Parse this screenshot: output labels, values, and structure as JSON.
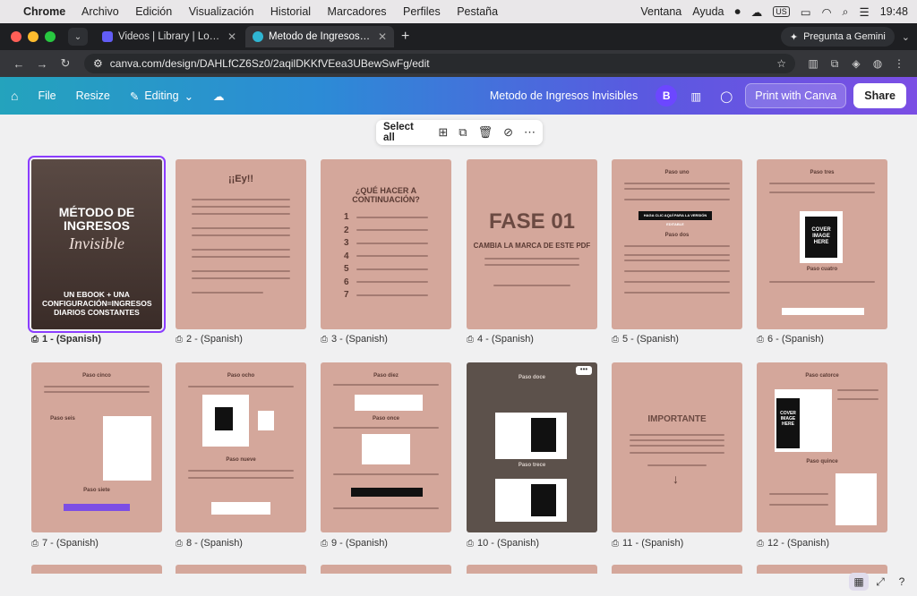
{
  "mac_menu": {
    "app": "Chrome",
    "items": [
      "Archivo",
      "Edición",
      "Visualización",
      "Historial",
      "Marcadores",
      "Perfiles",
      "Pestaña"
    ],
    "right": {
      "window": "Ventana",
      "help": "Ayuda",
      "keyboard": "US",
      "time": "19:48"
    }
  },
  "tabs": [
    {
      "title": "Videos | Library | Loom",
      "color": "#625df5"
    },
    {
      "title": "Metodo de Ingresos Invisibles",
      "color": "#2fb5d2"
    }
  ],
  "gemini_label": "Pregunta a Gemini",
  "url": "canva.com/design/DAHLfCZ6Sz0/2aqilDKKfVEea3UBewSwFg/edit",
  "canva_bar": {
    "file": "File",
    "resize": "Resize",
    "editing": "Editing",
    "doc_title": "Metodo de Ingresos Invisibles",
    "avatar": "B",
    "print": "Print with Canva",
    "share": "Share"
  },
  "page_toolbar": {
    "select_all": "Select all"
  },
  "pages": [
    {
      "caption": "1 - (Spanish)",
      "selected": true
    },
    {
      "caption": "2 - (Spanish)"
    },
    {
      "caption": "3 - (Spanish)"
    },
    {
      "caption": "4 - (Spanish)"
    },
    {
      "caption": "5 - (Spanish)"
    },
    {
      "caption": "6 - (Spanish)"
    },
    {
      "caption": "7 - (Spanish)"
    },
    {
      "caption": "8 - (Spanish)"
    },
    {
      "caption": "9 - (Spanish)"
    },
    {
      "caption": "10 - (Spanish)"
    },
    {
      "caption": "11 - (Spanish)"
    },
    {
      "caption": "12 - (Spanish)"
    }
  ],
  "page_text": {
    "p1_title": "MÉTODO DE INGRESOS",
    "p1_script": "Invisible",
    "p1_sub": "UN EBOOK + UNA CONFIGURACIÓN=INGRESOS DIARIOS CONSTANTES",
    "p2_title": "¡¡Ey!!",
    "p3_title": "¿QUÉ HACER A CONTINUACIÓN?",
    "p3_nums": [
      "1",
      "2",
      "3",
      "4",
      "5",
      "6",
      "7"
    ],
    "p4_title": "FASE 01",
    "p4_sub": "CAMBIA LA MARCA DE ESTE PDF",
    "p5_h1": "Paso uno",
    "p5_btn": "HAGA CLIC AQUÍ PARA LA VERSIÓN EDITABLE",
    "p5_h2": "Paso dos",
    "p6_h1": "Paso tres",
    "p6_cover": "COVER IMAGE HERE",
    "p6_h2": "Paso cuatro",
    "p7_h1": "Paso cinco",
    "p7_h2": "Paso seis",
    "p7_h3": "Paso siete",
    "p8_h1": "Paso ocho",
    "p8_h2": "Paso nueve",
    "p9_h1": "Paso diez",
    "p9_h2": "Paso once",
    "p10_h1": "Paso doce",
    "p10_h2": "Paso trece",
    "p11_title": "IMPORTANTE",
    "p12_h1": "Paso catorce",
    "p12_cover": "COVER IMAGE HERE",
    "p12_h2": "Paso quince"
  }
}
